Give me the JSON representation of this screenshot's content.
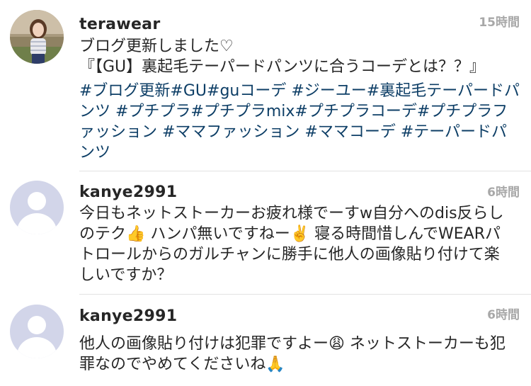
{
  "comments": [
    {
      "username": "terawear",
      "time": "15時間",
      "text_lines": [
        "ブログ更新しました♡",
        "『【GU】裏起毛テーパードパンツに合うコーデとは？？』"
      ],
      "hashtag_lines": [
        "#ブログ更新#GU#guコーデ #ジーユー#裏起毛テーパードパ",
        "ンツ #プチプラ#プチプラmix#プチプラコーデ#プチプラフ",
        "ァッション #ママファッション #ママコーデ #テーパードパ",
        "ンツ"
      ]
    },
    {
      "username": "kanye2991",
      "time": "6時間",
      "text_lines": [
        "今日もネットストーカーお疲れ様でーすw自分へのdis反らし",
        "のテク👍 ハンパ無いですねー✌️ 寝る時間惜しんでWEARパ",
        "トロールからのガルチャンに勝手に他人の画像貼り付けて楽",
        "しいですか？"
      ]
    },
    {
      "username": "kanye2991",
      "time": "6時間",
      "text_lines": [
        "他人の画像貼り付けは犯罪ですよー😩 ネットストーカーも犯",
        "罪なのでやめてくださいね🙏"
      ]
    }
  ]
}
